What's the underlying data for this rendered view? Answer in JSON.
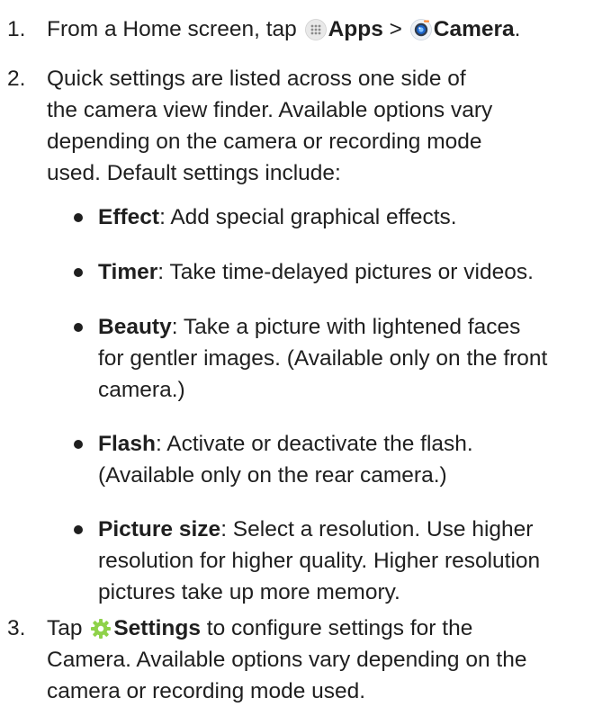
{
  "steps": [
    {
      "number": "1.",
      "text_before": "From a Home screen, tap",
      "apps_icon": "apps-grid-icon",
      "apps_label": "Apps",
      "separator": ">",
      "camera_icon": "camera-app-icon",
      "camera_label": "Camera",
      "text_after": "."
    },
    {
      "number": "2.",
      "lines": [
        "Quick settings are listed across one side of",
        "the camera view finder. Available options vary",
        "depending on the camera or recording mode",
        "used. Default settings include:"
      ],
      "bullets": [
        {
          "term": "Effect",
          "lines": [
            ": Add special graphical effects."
          ]
        },
        {
          "term": "Timer",
          "lines": [
            ": Take time-delayed pictures or videos."
          ]
        },
        {
          "term": "Beauty",
          "lines": [
            ": Take a picture with lightened faces",
            "for gentler images. (Available only on the front",
            "camera.)"
          ]
        },
        {
          "term": "Flash",
          "lines": [
            ": Activate or deactivate the flash.",
            "(Available only on the rear camera.)"
          ]
        },
        {
          "term": "Picture size",
          "lines": [
            ": Select a resolution. Use higher",
            "resolution for higher quality. Higher resolution",
            "pictures take up more memory."
          ]
        }
      ]
    },
    {
      "number": "3.",
      "text_before": "Tap",
      "settings_icon": "gear-icon",
      "settings_label": "Settings",
      "lines": [
        " to configure settings for the",
        "Camera. Available options vary depending on the",
        "camera or recording mode used."
      ]
    }
  ]
}
